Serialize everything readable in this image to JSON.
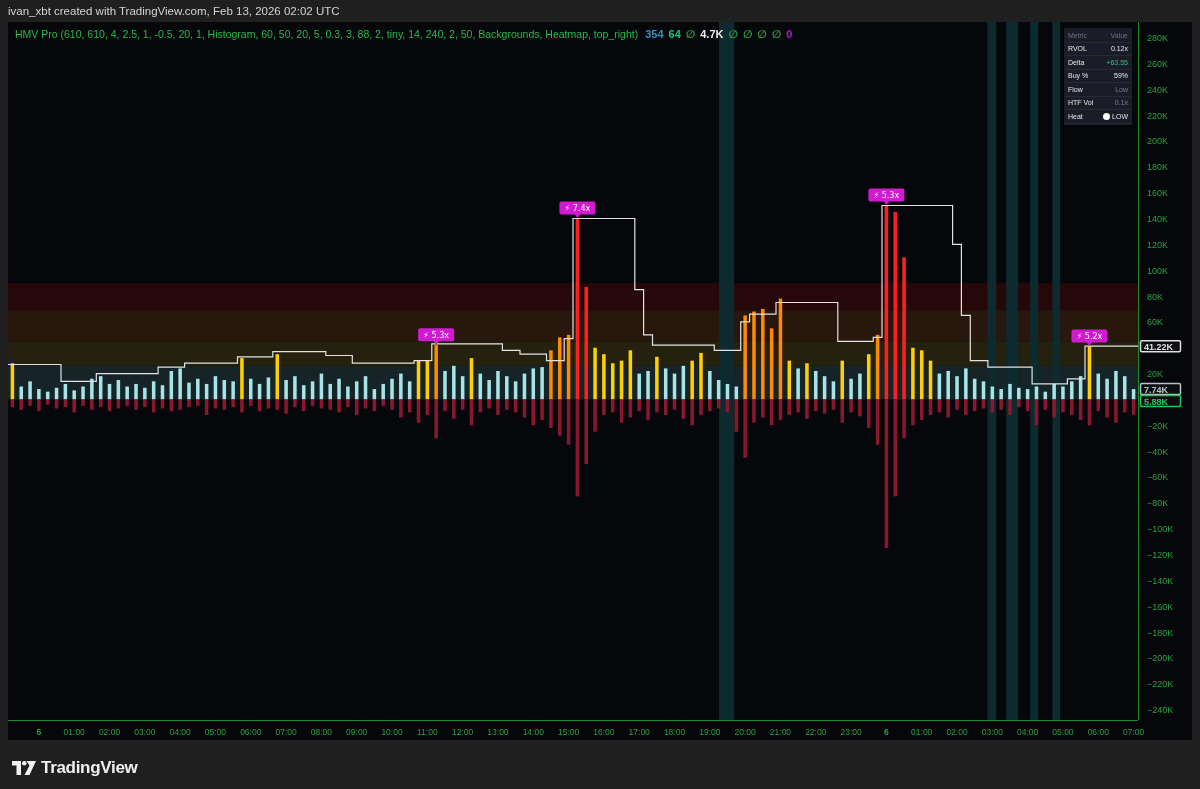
{
  "header": {
    "caption": "ivan_xbt created with TradingView.com, Feb 13, 2026 02:02 UTC"
  },
  "chart": {
    "legend": {
      "title": "HMV Pro (610, 610, 4, 2.5, 1, -0.5, 20, 1, Histogram, 60, 50, 20, 5, 0.3, 3, 88, 2, tiny, 14, 240, 2, 50, Backgrounds, Heatmap, top_right)",
      "values": [
        {
          "text": "354",
          "color": "#3e8fc0"
        },
        {
          "text": "64",
          "color": "#19c37d"
        },
        {
          "text": "∅",
          "color": "#2e9e3e"
        },
        {
          "text": "4.7K",
          "color": "#ececec"
        },
        {
          "text": "∅",
          "color": "#2e9e3e"
        },
        {
          "text": "∅",
          "color": "#2e9e3e"
        },
        {
          "text": "∅",
          "color": "#2e9e3e"
        },
        {
          "text": "∅",
          "color": "#2e9e3e"
        },
        {
          "text": "0",
          "color": "#a020d0"
        }
      ]
    },
    "metrics_table": {
      "columns": [
        "Metric",
        "Value"
      ],
      "rows": [
        {
          "metric": "RVOL",
          "value": "0.12x",
          "positive": false,
          "muted": false
        },
        {
          "metric": "Delta",
          "value": "+63.55",
          "positive": true,
          "muted": false
        },
        {
          "metric": "Buy %",
          "value": "59%",
          "positive": false,
          "muted": false
        },
        {
          "metric": "Flow",
          "value": "Low",
          "positive": false,
          "muted": true
        },
        {
          "metric": "HTF Vol",
          "value": "0.1x",
          "positive": false,
          "muted": true
        },
        {
          "metric": "Heat",
          "value": "LOW",
          "positive": false,
          "muted": false,
          "color": "#ffffff"
        }
      ]
    },
    "price_labels": [
      {
        "text": "41.22K",
        "color": "#e0e0e0"
      },
      {
        "text": "7.74K",
        "color": "#b8c4cc"
      },
      {
        "text": "5.88K",
        "color": "#22c55e"
      }
    ],
    "histogram": {
      "chart_data": {
        "type": "bar",
        "stacked": true,
        "ylim": [
          -248,
          292
        ],
        "categories": [
          null,
          null,
          null,
          "5",
          null,
          null,
          null,
          "01:00",
          null,
          null,
          null,
          "02:00",
          null,
          null,
          null,
          "03:00",
          null,
          null,
          null,
          "04:00",
          null,
          null,
          null,
          "05:00",
          null,
          null,
          null,
          "06:00",
          null,
          null,
          null,
          "07:00",
          null,
          null,
          null,
          "08:00",
          null,
          null,
          null,
          "09:00",
          null,
          null,
          null,
          "10:00",
          null,
          null,
          null,
          "11:00",
          null,
          null,
          null,
          "12:00",
          null,
          null,
          null,
          "13:00",
          null,
          null,
          null,
          "14:00",
          null,
          null,
          null,
          "15:00",
          null,
          null,
          null,
          "16:00",
          null,
          null,
          null,
          "17:00",
          null,
          null,
          null,
          "18:00",
          null,
          null,
          null,
          "19:00",
          null,
          null,
          null,
          "20:00",
          null,
          null,
          null,
          "21:00",
          null,
          null,
          null,
          "22:00",
          null,
          null,
          null,
          "23:00",
          null,
          null,
          null,
          "6",
          null,
          null,
          null,
          "01:00",
          null,
          null,
          null,
          "02:00",
          null,
          null,
          null,
          "03:00",
          null,
          null,
          null,
          "04:00",
          null,
          null,
          null,
          "05:00",
          null,
          null,
          null,
          "06:00",
          null,
          null,
          null,
          "07:00"
        ],
        "yticks": [
          {
            "value": 280,
            "label": "280K"
          },
          {
            "value": 260,
            "label": "260K"
          },
          {
            "value": 240,
            "label": "240K"
          },
          {
            "value": 220,
            "label": "220K"
          },
          {
            "value": 200,
            "label": "200K"
          },
          {
            "value": 180,
            "label": "180K"
          },
          {
            "value": 160,
            "label": "160K"
          },
          {
            "value": 140,
            "label": "140K"
          },
          {
            "value": 120,
            "label": "120K"
          },
          {
            "value": 100,
            "label": "100K"
          },
          {
            "value": 80,
            "label": "80K"
          },
          {
            "value": 60,
            "label": "60K"
          },
          {
            "value": 20,
            "label": "20K"
          },
          {
            "value": -20,
            "label": "−20K"
          },
          {
            "value": -40,
            "label": "−40K"
          },
          {
            "value": -60,
            "label": "−60K"
          },
          {
            "value": -80,
            "label": "−80K"
          },
          {
            "value": -100,
            "label": "−100K"
          },
          {
            "value": -120,
            "label": "−120K"
          },
          {
            "value": -140,
            "label": "−140K"
          },
          {
            "value": -160,
            "label": "−160K"
          },
          {
            "value": -180,
            "label": "−180K"
          },
          {
            "value": -200,
            "label": "−200K"
          },
          {
            "value": -220,
            "label": "−220K"
          },
          {
            "value": -240,
            "label": "−240K"
          }
        ],
        "series": [
          {
            "color": "#a6e4e8",
            "values": [
              null,
              10,
              14,
              8,
              6,
              9,
              12,
              7,
              10,
              16,
              18,
              12,
              15,
              10,
              12,
              9,
              14,
              11,
              22,
              24,
              13,
              16,
              12,
              18,
              15,
              14,
              null,
              16,
              12,
              17,
              null,
              15,
              18,
              11,
              14,
              20,
              12,
              16,
              10,
              14,
              18,
              8,
              12,
              16,
              20,
              14,
              null,
              null,
              null,
              22,
              26,
              18,
              null,
              20,
              15,
              22,
              18,
              14,
              20,
              24,
              25,
              null,
              null,
              null,
              null,
              null,
              null,
              null,
              null,
              null,
              null,
              20,
              22,
              null,
              24,
              20,
              26,
              null,
              null,
              22,
              15,
              12,
              10,
              null,
              null,
              null,
              null,
              null,
              null,
              24,
              null,
              22,
              18,
              14,
              null,
              16,
              20,
              null,
              null,
              null,
              null,
              null,
              null,
              null,
              null,
              20,
              22,
              18,
              24,
              16,
              14,
              10,
              8,
              12,
              9,
              8,
              10,
              6,
              12,
              10,
              14,
              18,
              null,
              20,
              16,
              22,
              18,
              8
            ]
          },
          {
            "color": "#ffcf00",
            "values": [
              28,
              null,
              null,
              null,
              null,
              null,
              null,
              null,
              null,
              null,
              null,
              null,
              null,
              null,
              null,
              null,
              null,
              null,
              null,
              null,
              null,
              null,
              null,
              null,
              null,
              null,
              32,
              null,
              null,
              null,
              35,
              null,
              null,
              null,
              null,
              null,
              null,
              null,
              null,
              null,
              null,
              null,
              null,
              null,
              null,
              null,
              30,
              30,
              null,
              null,
              null,
              null,
              32,
              null,
              null,
              null,
              null,
              null,
              null,
              null,
              null,
              null,
              null,
              null,
              null,
              null,
              40,
              35,
              28,
              30,
              38,
              null,
              null,
              33,
              null,
              null,
              null,
              30,
              36,
              null,
              null,
              null,
              null,
              null,
              null,
              null,
              null,
              null,
              30,
              null,
              28,
              null,
              null,
              null,
              30,
              null,
              null,
              35,
              null,
              null,
              null,
              null,
              40,
              38,
              30,
              null,
              null,
              null,
              null,
              null,
              null,
              null,
              null,
              null,
              null,
              null,
              null,
              null,
              null,
              null,
              null,
              null,
              41,
              null,
              null,
              null,
              null,
              null
            ]
          },
          {
            "color": "#ff8a00",
            "values": [
              null,
              null,
              null,
              null,
              null,
              null,
              null,
              null,
              null,
              null,
              null,
              null,
              null,
              null,
              null,
              null,
              null,
              null,
              null,
              null,
              null,
              null,
              null,
              null,
              null,
              null,
              null,
              null,
              null,
              null,
              null,
              null,
              null,
              null,
              null,
              null,
              null,
              null,
              null,
              null,
              null,
              null,
              null,
              null,
              null,
              null,
              null,
              null,
              42,
              null,
              null,
              null,
              null,
              null,
              null,
              null,
              null,
              null,
              null,
              null,
              null,
              38,
              48,
              50,
              null,
              null,
              null,
              null,
              null,
              null,
              null,
              null,
              null,
              null,
              null,
              null,
              null,
              null,
              null,
              null,
              null,
              null,
              null,
              65,
              68,
              70,
              55,
              78,
              null,
              null,
              null,
              null,
              null,
              null,
              null,
              null,
              null,
              null,
              50,
              null,
              null,
              null,
              null,
              null,
              null,
              null,
              null,
              null,
              null,
              null,
              null,
              null,
              null,
              null,
              null,
              null,
              null,
              null,
              null,
              null,
              null,
              null,
              null,
              null,
              null,
              null,
              null,
              null
            ]
          },
          {
            "color": "#ff1f1f",
            "values": [
              null,
              null,
              null,
              null,
              null,
              null,
              null,
              null,
              null,
              null,
              null,
              null,
              null,
              null,
              null,
              null,
              null,
              null,
              null,
              null,
              null,
              null,
              null,
              null,
              null,
              null,
              null,
              null,
              null,
              null,
              null,
              null,
              null,
              null,
              null,
              null,
              null,
              null,
              null,
              null,
              null,
              null,
              null,
              null,
              null,
              null,
              null,
              null,
              null,
              null,
              null,
              null,
              null,
              null,
              null,
              null,
              null,
              null,
              null,
              null,
              null,
              null,
              null,
              null,
              140,
              87,
              null,
              null,
              null,
              null,
              null,
              null,
              null,
              null,
              null,
              null,
              null,
              null,
              null,
              null,
              null,
              null,
              null,
              null,
              null,
              null,
              null,
              null,
              null,
              null,
              null,
              null,
              null,
              null,
              null,
              null,
              null,
              null,
              null,
              150,
              145,
              110,
              null,
              null,
              null,
              null,
              null,
              null,
              null,
              null,
              null,
              null,
              null,
              null,
              null,
              null,
              null,
              null,
              null,
              null,
              null,
              null,
              null,
              null,
              null,
              null,
              null,
              null
            ]
          },
          {
            "color": "#8a1730",
            "values": [
              -6,
              -8,
              -5,
              -9,
              -4,
              -7,
              -6,
              -10,
              -5,
              -8,
              -6,
              -9,
              -7,
              -5,
              -8,
              -6,
              -10,
              -7,
              -9,
              -8,
              -6,
              -5,
              -12,
              -7,
              -8,
              -6,
              -10,
              -5,
              -9,
              -7,
              -8,
              -11,
              -6,
              -9,
              -5,
              -7,
              -8,
              -10,
              -6,
              -12,
              -7,
              -9,
              -5,
              -8,
              -14,
              -10,
              -18,
              -12,
              -30,
              -9,
              -15,
              -8,
              -20,
              -10,
              -7,
              -12,
              -8,
              -10,
              -14,
              -20,
              -16,
              -22,
              -28,
              -35,
              -75,
              -50,
              -25,
              -12,
              -10,
              -18,
              -14,
              -9,
              -16,
              -10,
              -12,
              -8,
              -15,
              -20,
              -12,
              -9,
              -7,
              -10,
              -25,
              -45,
              -18,
              -14,
              -20,
              -16,
              -12,
              -10,
              -15,
              -9,
              -11,
              -8,
              -18,
              -10,
              -13,
              -22,
              -35,
              -115,
              -75,
              -30,
              -20,
              -16,
              -12,
              -10,
              -14,
              -8,
              -12,
              -9,
              -7,
              -10,
              -8,
              -12,
              -6,
              -9,
              -20,
              -8,
              -14,
              -10,
              -12,
              -16,
              -20,
              -9,
              -14,
              -18,
              -10,
              -12
            ]
          }
        ],
        "bands": [
          {
            "axis": "y",
            "from": 0,
            "to": 26,
            "color": "#162428"
          },
          {
            "axis": "y",
            "from": 26,
            "to": 45,
            "color": "#24220e"
          },
          {
            "axis": "y",
            "from": 45,
            "to": 69,
            "color": "#28170c"
          },
          {
            "axis": "y",
            "from": 69,
            "to": 90,
            "color": "#26080b"
          }
        ],
        "annotations": [
          {
            "text": "⚡ 5.3x",
            "y": 42
          },
          {
            "text": "⚡ 7.4x",
            "y": 140
          },
          {
            "text": "⚡ 5.3x",
            "y": 150
          },
          {
            "text": "⚡ 5.2x",
            "y": 41
          }
        ]
      }
    }
  },
  "footer": {
    "logo_text": "TradingView"
  }
}
